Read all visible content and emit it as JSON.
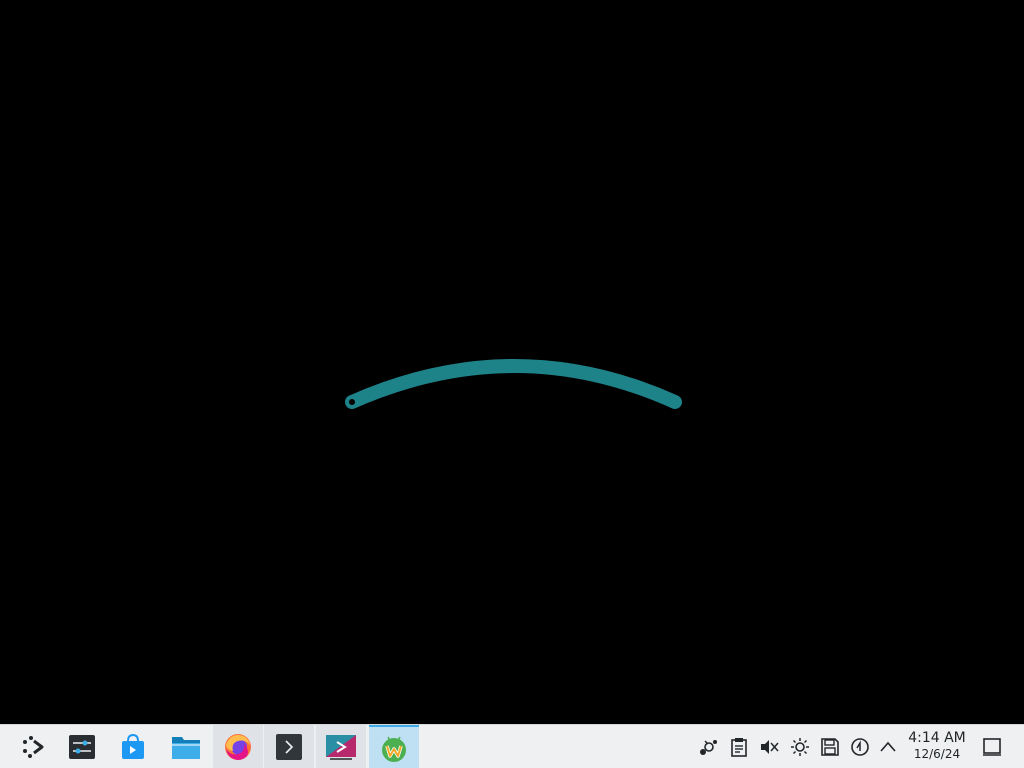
{
  "desktop": {
    "background": "#000000",
    "spinner_color": "#1e8289"
  },
  "taskbar": {
    "launcher": {
      "icon": "application-launcher-icon"
    },
    "tasks": [
      {
        "icon": "system-settings-icon",
        "state": "pinned"
      },
      {
        "icon": "discover-store-icon",
        "state": "pinned"
      },
      {
        "icon": "dolphin-file-manager-icon",
        "state": "pinned"
      },
      {
        "icon": "firefox-icon",
        "state": "running"
      },
      {
        "icon": "terminal-icon",
        "state": "running"
      },
      {
        "icon": "screenshot-tool-icon",
        "state": "running"
      },
      {
        "icon": "waydroid-icon",
        "state": "active"
      }
    ],
    "tray": [
      "network-icon",
      "clipboard-icon",
      "volume-muted-icon",
      "brightness-icon",
      "disks-icon",
      "update-notifier-icon",
      "show-hidden-chevron-icon"
    ],
    "clock": {
      "time": "4:14 AM",
      "date": "12/6/24"
    },
    "show_desktop": {
      "icon": "show-desktop-icon"
    }
  }
}
